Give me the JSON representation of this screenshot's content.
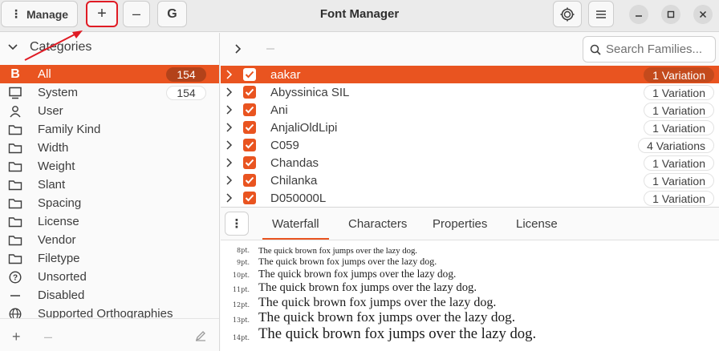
{
  "header": {
    "title": "Font Manager",
    "manage_label": "Manage",
    "add_label": "+",
    "remove_label": "–",
    "g_label": "G"
  },
  "sidebar": {
    "header_label": "Categories",
    "items": [
      {
        "label": "All",
        "count": "154",
        "icon": "bold-b-icon"
      },
      {
        "label": "System",
        "count": "154",
        "icon": "monitor-icon"
      },
      {
        "label": "User",
        "icon": "user-icon"
      },
      {
        "label": "Family Kind",
        "icon": "folder-icon"
      },
      {
        "label": "Width",
        "icon": "folder-icon"
      },
      {
        "label": "Weight",
        "icon": "folder-icon"
      },
      {
        "label": "Slant",
        "icon": "folder-icon"
      },
      {
        "label": "Spacing",
        "icon": "folder-icon"
      },
      {
        "label": "License",
        "icon": "folder-icon"
      },
      {
        "label": "Vendor",
        "icon": "folder-icon"
      },
      {
        "label": "Filetype",
        "icon": "folder-icon"
      },
      {
        "label": "Unsorted",
        "icon": "question-icon"
      },
      {
        "label": "Disabled",
        "icon": "dash-icon"
      },
      {
        "label": "Supported Orthographies",
        "icon": "globe-icon"
      }
    ],
    "footer": {
      "add_label": "+",
      "remove_label": "–"
    }
  },
  "search": {
    "placeholder": "Search Families..."
  },
  "fonts": [
    {
      "name": "aakar",
      "variations": "1 Variation"
    },
    {
      "name": "Abyssinica SIL",
      "variations": "1 Variation"
    },
    {
      "name": "Ani",
      "variations": "1 Variation"
    },
    {
      "name": "AnjaliOldLipi",
      "variations": "1 Variation"
    },
    {
      "name": "C059",
      "variations": "4 Variations"
    },
    {
      "name": "Chandas",
      "variations": "1 Variation"
    },
    {
      "name": "Chilanka",
      "variations": "1 Variation"
    },
    {
      "name": "D050000L",
      "variations": "1 Variation"
    }
  ],
  "tabs": [
    "Waterfall",
    "Characters",
    "Properties",
    "License"
  ],
  "waterfall": [
    {
      "size": "8pt.",
      "text": "The quick brown fox jumps over the lazy dog."
    },
    {
      "size": "9pt.",
      "text": "The quick brown fox jumps over the lazy dog."
    },
    {
      "size": "10pt.",
      "text": "The quick brown fox jumps over the lazy dog."
    },
    {
      "size": "11pt.",
      "text": "The quick brown fox jumps over the lazy dog."
    },
    {
      "size": "12pt.",
      "text": "The quick brown fox jumps over the lazy dog."
    },
    {
      "size": "13pt.",
      "text": "The quick brown fox jumps over the lazy dog."
    },
    {
      "size": "14pt.",
      "text": "The quick brown fox jumps over the lazy dog."
    }
  ],
  "colors": {
    "accent": "#e95420",
    "annotation": "#e01b24"
  }
}
